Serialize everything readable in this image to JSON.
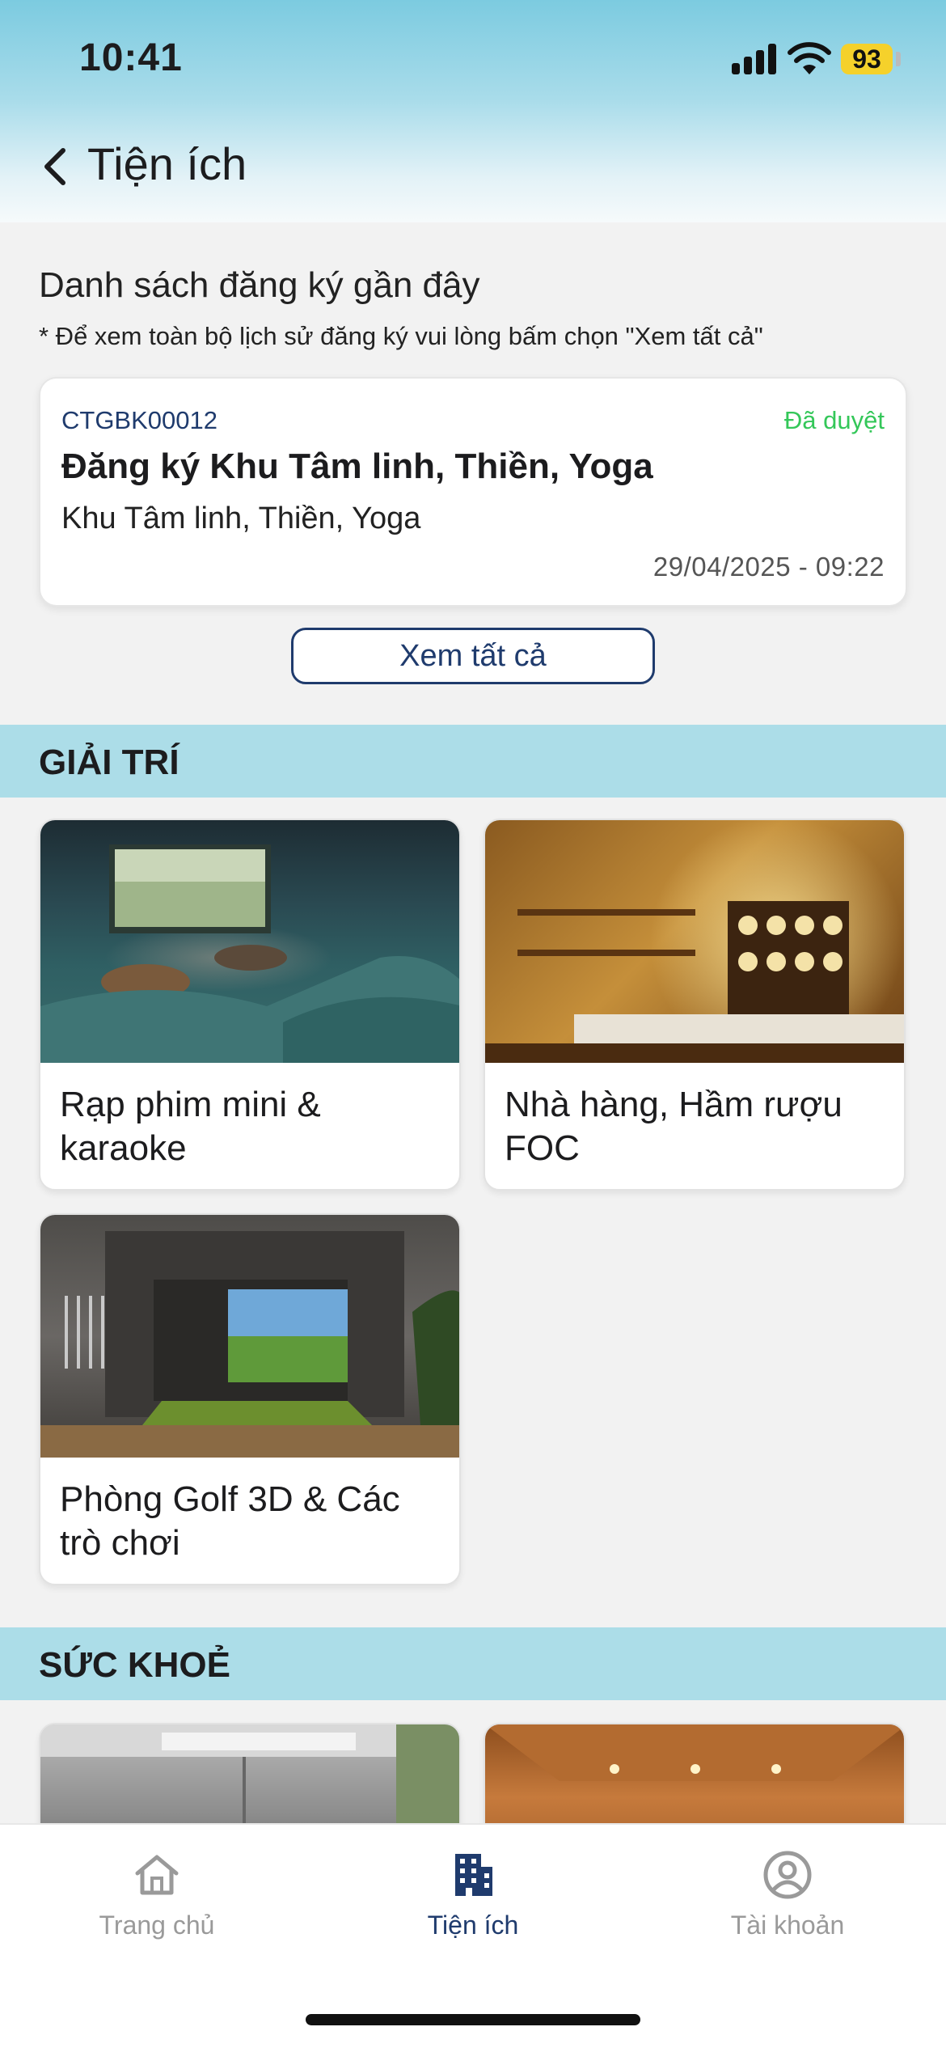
{
  "status_bar": {
    "time": "10:41",
    "battery": "93"
  },
  "header": {
    "title": "Tiện ích"
  },
  "recent": {
    "title": "Danh sách đăng ký gần đây",
    "note": "* Để xem toàn bộ lịch sử đăng ký vui lòng bấm chọn \"Xem tất cả\"",
    "card": {
      "code": "CTGBK00012",
      "status": "Đã duyệt",
      "title": "Đăng ký Khu Tâm linh, Thiền, Yoga",
      "subtitle": "Khu Tâm linh, Thiền, Yoga",
      "datetime": "29/04/2025 - 09:22"
    },
    "view_all_label": "Xem tất cả"
  },
  "sections": {
    "entertainment": {
      "title": "GIẢI TRÍ",
      "items": [
        {
          "label": "Rạp phim mini & karaoke"
        },
        {
          "label": "Nhà hàng, Hầm rượu FOC"
        },
        {
          "label": "Phòng Golf 3D & Các trò chơi"
        }
      ]
    },
    "health": {
      "title": "SỨC KHOẺ"
    }
  },
  "tabbar": {
    "items": [
      {
        "label": "Trang chủ",
        "icon": "home-icon"
      },
      {
        "label": "Tiện ích",
        "icon": "building-icon"
      },
      {
        "label": "Tài khoản",
        "icon": "account-icon"
      }
    ],
    "active_index": 1
  },
  "colors": {
    "accent": "#1f3b6d",
    "approved": "#34c759",
    "section_bar": "#acdde8"
  }
}
